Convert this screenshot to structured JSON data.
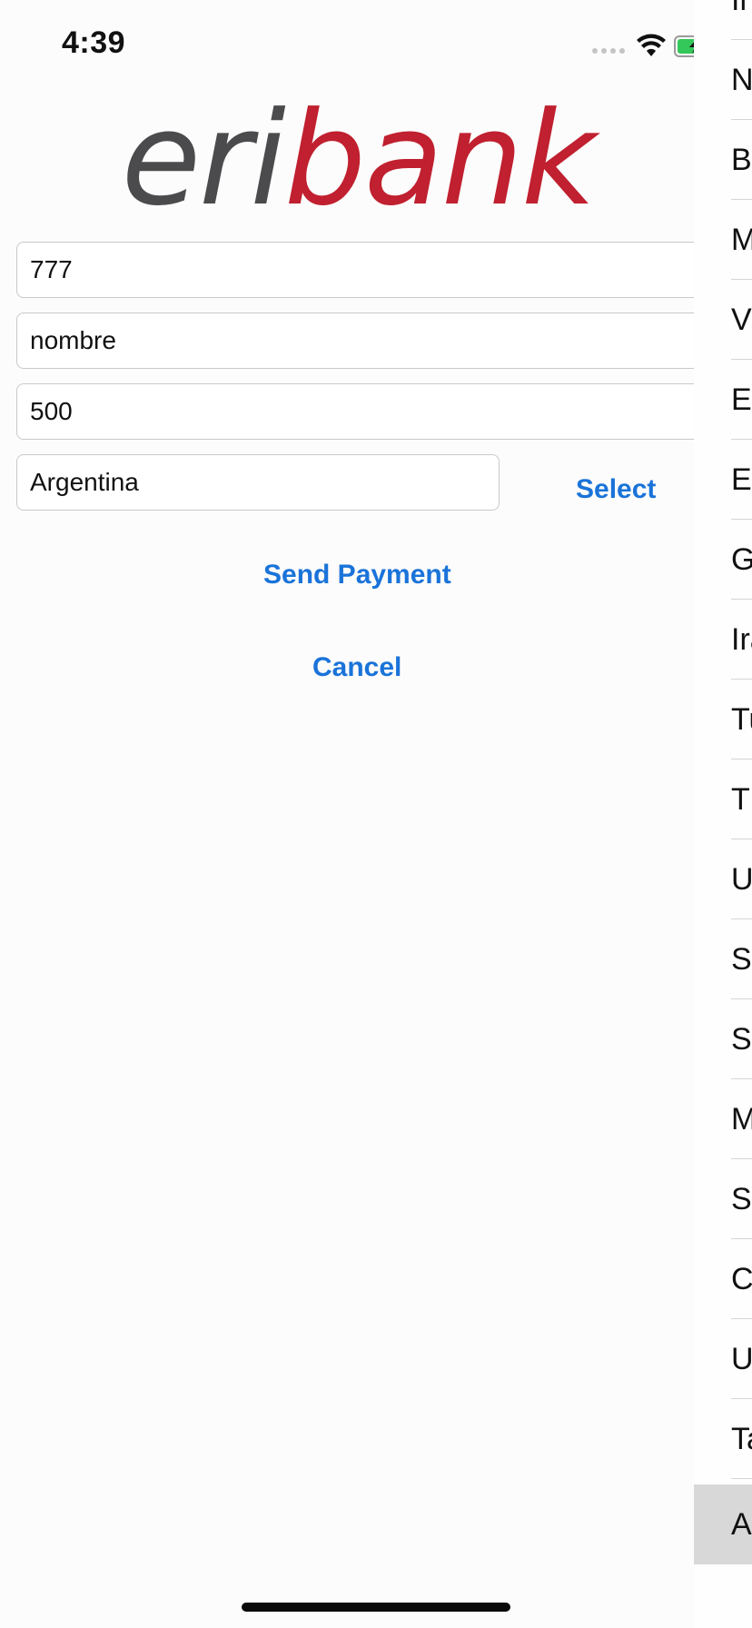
{
  "status_bar": {
    "time": "4:39"
  },
  "logo": {
    "part1": "eri",
    "part2": "bank",
    "colors": {
      "eri": "#4b4b4d",
      "bank": "#c0202f"
    }
  },
  "form": {
    "account_value": "777",
    "name_value": "nombre",
    "amount_value": "500",
    "country_value": "Argentina",
    "select_label": "Select",
    "send_label": "Send Payment",
    "cancel_label": "Cancel"
  },
  "picker": {
    "items": [
      {
        "label": "In"
      },
      {
        "label": "N"
      },
      {
        "label": "Ba"
      },
      {
        "label": "M"
      },
      {
        "label": "V"
      },
      {
        "label": "Et"
      },
      {
        "label": "Eg"
      },
      {
        "label": "G"
      },
      {
        "label": "Ira"
      },
      {
        "label": "Tu"
      },
      {
        "label": "Th"
      },
      {
        "label": "U"
      },
      {
        "label": "So"
      },
      {
        "label": "So"
      },
      {
        "label": "M"
      },
      {
        "label": "Sp"
      },
      {
        "label": "C"
      },
      {
        "label": "U"
      },
      {
        "label": "Ta"
      },
      {
        "label": "A"
      }
    ],
    "selected_index": 19
  },
  "colors": {
    "accent": "#1a73d9",
    "background": "#fcfcfc"
  },
  "icons": {
    "wifi": "wifi-icon",
    "battery": "battery-charging-icon",
    "signal": "signal-dots-icon"
  }
}
